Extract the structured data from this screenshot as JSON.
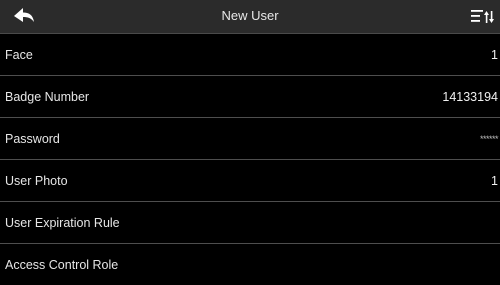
{
  "header": {
    "title": "New User",
    "back_icon": "back-arrow-icon",
    "menu_icon": "menu-sort-icon"
  },
  "rows": [
    {
      "label": "Face",
      "value": "1"
    },
    {
      "label": "Badge Number",
      "value": "14133194"
    },
    {
      "label": "Password",
      "value": "******"
    },
    {
      "label": "User Photo",
      "value": "1"
    },
    {
      "label": "User Expiration Rule",
      "value": ""
    },
    {
      "label": "Access Control Role",
      "value": ""
    }
  ],
  "colors": {
    "background": "#000000",
    "header_background": "#2b2b2b",
    "divider": "#4e4e4e",
    "text": "#ffffff"
  }
}
